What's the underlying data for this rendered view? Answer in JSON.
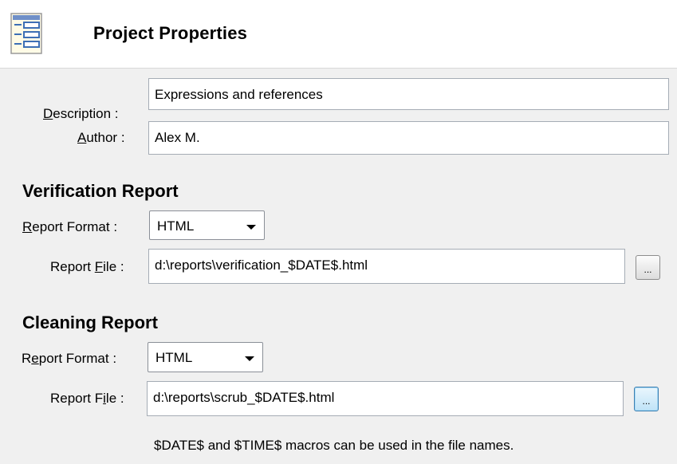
{
  "header": {
    "title": "Project Properties",
    "icon": "properties-list-icon"
  },
  "general": {
    "description_label_accel": "D",
    "description_label_rest": "escription :",
    "description_value": "Expressions and references",
    "author_label_accel": "A",
    "author_label_rest": "uthor :",
    "author_value": "Alex M."
  },
  "verification": {
    "title": "Verification Report",
    "format_label_accel": "R",
    "format_label_rest": "eport Format :",
    "format_value": "HTML",
    "file_label_pre": "Report ",
    "file_label_accel": "F",
    "file_label_post": "ile :",
    "file_value": "d:\\reports\\verification_$DATE$.html",
    "browse_label": "..."
  },
  "cleaning": {
    "title": "Cleaning Report",
    "format_label_pre": "R",
    "format_label_accel": "e",
    "format_label_post": "port Format :",
    "format_value": "HTML",
    "file_label_pre": "Report F",
    "file_label_accel": "i",
    "file_label_post": "le :",
    "file_value": "d:\\reports\\scrub_$DATE$.html",
    "browse_label": "..."
  },
  "hint": "$DATE$ and $TIME$ macros can be used in the file names."
}
